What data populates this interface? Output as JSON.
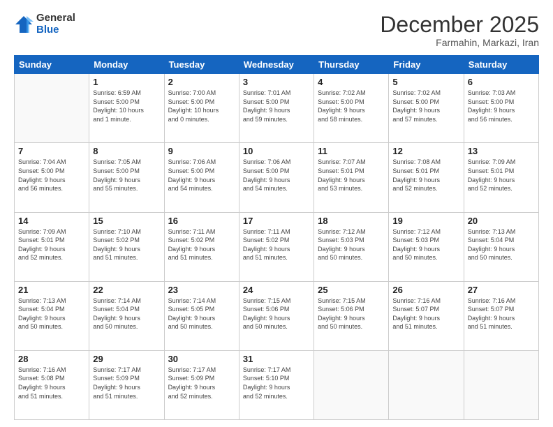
{
  "header": {
    "logo_general": "General",
    "logo_blue": "Blue",
    "month_title": "December 2025",
    "subtitle": "Farmahin, Markazi, Iran"
  },
  "days_of_week": [
    "Sunday",
    "Monday",
    "Tuesday",
    "Wednesday",
    "Thursday",
    "Friday",
    "Saturday"
  ],
  "weeks": [
    [
      {
        "day": "",
        "info": ""
      },
      {
        "day": "1",
        "info": "Sunrise: 6:59 AM\nSunset: 5:00 PM\nDaylight: 10 hours\nand 1 minute."
      },
      {
        "day": "2",
        "info": "Sunrise: 7:00 AM\nSunset: 5:00 PM\nDaylight: 10 hours\nand 0 minutes."
      },
      {
        "day": "3",
        "info": "Sunrise: 7:01 AM\nSunset: 5:00 PM\nDaylight: 9 hours\nand 59 minutes."
      },
      {
        "day": "4",
        "info": "Sunrise: 7:02 AM\nSunset: 5:00 PM\nDaylight: 9 hours\nand 58 minutes."
      },
      {
        "day": "5",
        "info": "Sunrise: 7:02 AM\nSunset: 5:00 PM\nDaylight: 9 hours\nand 57 minutes."
      },
      {
        "day": "6",
        "info": "Sunrise: 7:03 AM\nSunset: 5:00 PM\nDaylight: 9 hours\nand 56 minutes."
      }
    ],
    [
      {
        "day": "7",
        "info": "Sunrise: 7:04 AM\nSunset: 5:00 PM\nDaylight: 9 hours\nand 56 minutes."
      },
      {
        "day": "8",
        "info": "Sunrise: 7:05 AM\nSunset: 5:00 PM\nDaylight: 9 hours\nand 55 minutes."
      },
      {
        "day": "9",
        "info": "Sunrise: 7:06 AM\nSunset: 5:00 PM\nDaylight: 9 hours\nand 54 minutes."
      },
      {
        "day": "10",
        "info": "Sunrise: 7:06 AM\nSunset: 5:00 PM\nDaylight: 9 hours\nand 54 minutes."
      },
      {
        "day": "11",
        "info": "Sunrise: 7:07 AM\nSunset: 5:01 PM\nDaylight: 9 hours\nand 53 minutes."
      },
      {
        "day": "12",
        "info": "Sunrise: 7:08 AM\nSunset: 5:01 PM\nDaylight: 9 hours\nand 52 minutes."
      },
      {
        "day": "13",
        "info": "Sunrise: 7:09 AM\nSunset: 5:01 PM\nDaylight: 9 hours\nand 52 minutes."
      }
    ],
    [
      {
        "day": "14",
        "info": "Sunrise: 7:09 AM\nSunset: 5:01 PM\nDaylight: 9 hours\nand 52 minutes."
      },
      {
        "day": "15",
        "info": "Sunrise: 7:10 AM\nSunset: 5:02 PM\nDaylight: 9 hours\nand 51 minutes."
      },
      {
        "day": "16",
        "info": "Sunrise: 7:11 AM\nSunset: 5:02 PM\nDaylight: 9 hours\nand 51 minutes."
      },
      {
        "day": "17",
        "info": "Sunrise: 7:11 AM\nSunset: 5:02 PM\nDaylight: 9 hours\nand 51 minutes."
      },
      {
        "day": "18",
        "info": "Sunrise: 7:12 AM\nSunset: 5:03 PM\nDaylight: 9 hours\nand 50 minutes."
      },
      {
        "day": "19",
        "info": "Sunrise: 7:12 AM\nSunset: 5:03 PM\nDaylight: 9 hours\nand 50 minutes."
      },
      {
        "day": "20",
        "info": "Sunrise: 7:13 AM\nSunset: 5:04 PM\nDaylight: 9 hours\nand 50 minutes."
      }
    ],
    [
      {
        "day": "21",
        "info": "Sunrise: 7:13 AM\nSunset: 5:04 PM\nDaylight: 9 hours\nand 50 minutes."
      },
      {
        "day": "22",
        "info": "Sunrise: 7:14 AM\nSunset: 5:04 PM\nDaylight: 9 hours\nand 50 minutes."
      },
      {
        "day": "23",
        "info": "Sunrise: 7:14 AM\nSunset: 5:05 PM\nDaylight: 9 hours\nand 50 minutes."
      },
      {
        "day": "24",
        "info": "Sunrise: 7:15 AM\nSunset: 5:06 PM\nDaylight: 9 hours\nand 50 minutes."
      },
      {
        "day": "25",
        "info": "Sunrise: 7:15 AM\nSunset: 5:06 PM\nDaylight: 9 hours\nand 50 minutes."
      },
      {
        "day": "26",
        "info": "Sunrise: 7:16 AM\nSunset: 5:07 PM\nDaylight: 9 hours\nand 51 minutes."
      },
      {
        "day": "27",
        "info": "Sunrise: 7:16 AM\nSunset: 5:07 PM\nDaylight: 9 hours\nand 51 minutes."
      }
    ],
    [
      {
        "day": "28",
        "info": "Sunrise: 7:16 AM\nSunset: 5:08 PM\nDaylight: 9 hours\nand 51 minutes."
      },
      {
        "day": "29",
        "info": "Sunrise: 7:17 AM\nSunset: 5:09 PM\nDaylight: 9 hours\nand 51 minutes."
      },
      {
        "day": "30",
        "info": "Sunrise: 7:17 AM\nSunset: 5:09 PM\nDaylight: 9 hours\nand 52 minutes."
      },
      {
        "day": "31",
        "info": "Sunrise: 7:17 AM\nSunset: 5:10 PM\nDaylight: 9 hours\nand 52 minutes."
      },
      {
        "day": "",
        "info": ""
      },
      {
        "day": "",
        "info": ""
      },
      {
        "day": "",
        "info": ""
      }
    ]
  ]
}
